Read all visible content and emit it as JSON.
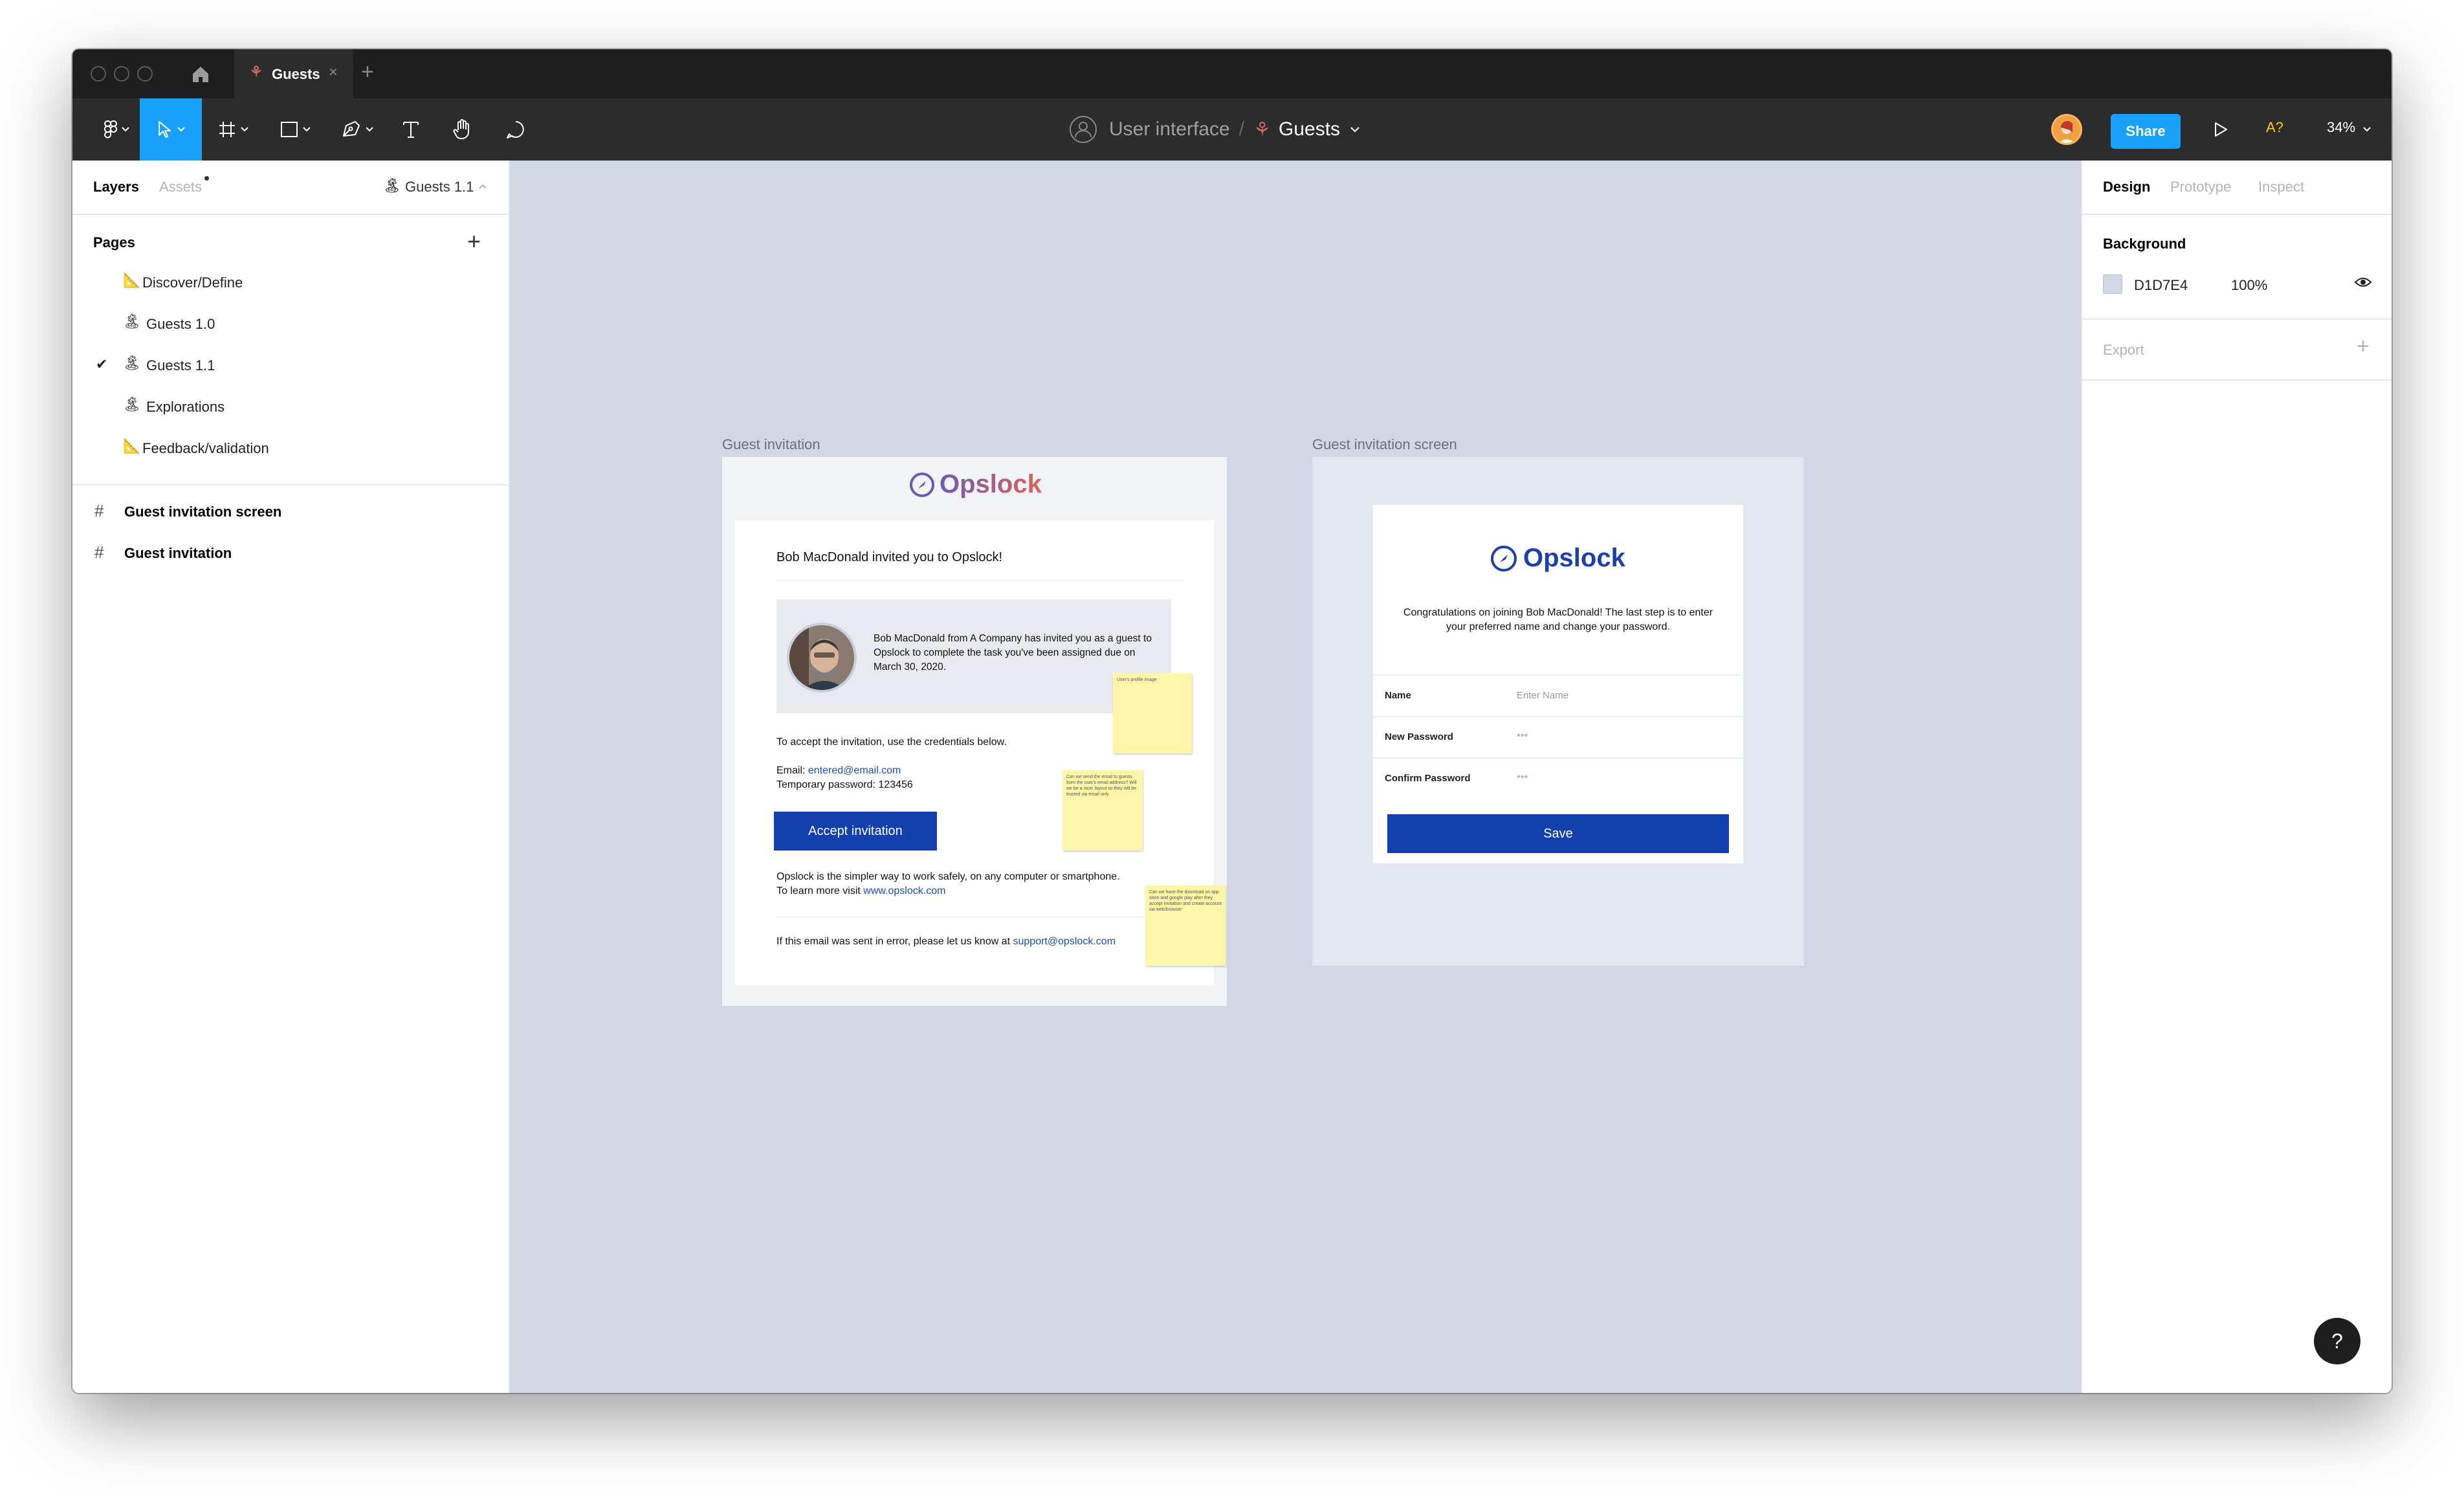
{
  "window": {
    "tab_title": "Guests",
    "tab_close": "×",
    "new_tab": "+"
  },
  "toolbar": {
    "project": "User interface",
    "separator": "/",
    "file": "Guests",
    "share_label": "Share",
    "a11y_label": "A?",
    "zoom": "34%"
  },
  "left_panel": {
    "tab_layers": "Layers",
    "tab_assets": "Assets",
    "current_page": "Guests 1.1",
    "pages_heading": "Pages",
    "pages_add": "+",
    "pages": [
      {
        "label": "Discover/Define",
        "icon": "📐",
        "selected": false
      },
      {
        "label": "Guests 1.0",
        "icon": "🏝",
        "selected": false
      },
      {
        "label": "Guests 1.1",
        "icon": "🏝",
        "selected": true
      },
      {
        "label": "Explorations",
        "icon": "🏝",
        "selected": false
      },
      {
        "label": "Feedback/validation",
        "icon": "📐",
        "selected": false
      }
    ],
    "layers": [
      {
        "label": "Guest invitation screen"
      },
      {
        "label": "Guest invitation"
      }
    ]
  },
  "right_panel": {
    "tab_design": "Design",
    "tab_prototype": "Prototype",
    "tab_inspect": "Inspect",
    "background_heading": "Background",
    "background_hex": "D1D7E4",
    "background_opacity": "100%",
    "export_heading": "Export",
    "export_add": "+"
  },
  "help_label": "?",
  "canvas": {
    "background_color": "#D1D7E4",
    "frame1": {
      "label": "Guest invitation",
      "logo_text": "Opslock",
      "title": "Bob MacDonald invited you to Opslock!",
      "quote": "Bob MacDonald from A Company has invited you as a guest to Opslock to complete the task you've been assigned due on March 30, 2020.",
      "instructions": "To accept the invitation, use the credentials below.",
      "email_label": "Email: ",
      "email_value": "entered@email.com",
      "temp_password": "Temporary password: 123456",
      "accept_button": "Accept invitation",
      "about_text": "Opslock is the simpler way to work safely, on any computer or smartphone. To learn more visit ",
      "about_link": "www.opslock.com",
      "error_text": "If this email was sent in error, please let us know at ",
      "error_link": "support@opslock.com",
      "sticky1": "User's profile image",
      "sticky2": "Can we send the email to guests from the user's email address? Will we be a nicer layout so they will be trusted via email only",
      "sticky3": "Can we have the download on app store and google play after they accept invitation and create account via web/browser"
    },
    "frame2": {
      "label": "Guest invitation screen",
      "logo_text": "Opslock",
      "message": "Congratulations on joining Bob MacDonald! The last step is to enter your preferred name and change your password.",
      "fields": [
        {
          "label": "Name",
          "value": "Enter Name"
        },
        {
          "label": "New Password",
          "value": "***"
        },
        {
          "label": "Confirm Password",
          "value": "***"
        }
      ],
      "save_button": "Save"
    }
  },
  "colors": {
    "accent": "#18A0FB",
    "brand_blue": "#1340AD",
    "titlebar": "#1E1E1E",
    "toolbar": "#2C2C2C",
    "sticky": "#FFF5A8"
  }
}
